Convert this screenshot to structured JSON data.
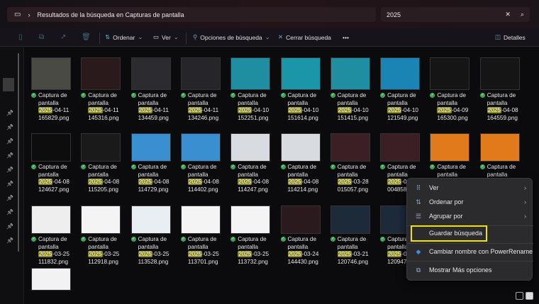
{
  "address": {
    "path": "Resultados de la búsqueda en Capturas de pantalla"
  },
  "search": {
    "value": "2025"
  },
  "toolbar": {
    "sort": "Ordenar",
    "view": "Ver",
    "search_options": "Opciones de búsqueda",
    "close_search": "Cerrar búsqueda",
    "more": "•••",
    "details": "Detalles"
  },
  "items": [
    {
      "l1": "Captura de",
      "l2": "pantalla",
      "hl": "2025",
      "date": "-04-11",
      "time": "165829.png",
      "thumb": "#4a4a44"
    },
    {
      "l1": "Captura de",
      "l2": "pantalla",
      "hl": "2025",
      "date": "-04-11",
      "time": "145316.png",
      "thumb": "#2a1a1c"
    },
    {
      "l1": "Captura de",
      "l2": "pantalla",
      "hl": "2025",
      "date": "-04-11",
      "time": "134459.png",
      "thumb": "#2c2c30"
    },
    {
      "l1": "Captura de",
      "l2": "pantalla",
      "hl": "2025",
      "date": "-04-11",
      "time": "134246.png",
      "thumb": "#26262a"
    },
    {
      "l1": "Captura de",
      "l2": "pantalla",
      "hl": "2025",
      "date": "-04-10",
      "time": "152251.png",
      "thumb": "#1e8ea0"
    },
    {
      "l1": "Captura de",
      "l2": "pantalla",
      "hl": "2025",
      "date": "-04-10",
      "time": "151614.png",
      "thumb": "#1b95a8"
    },
    {
      "l1": "Captura de",
      "l2": "pantalla",
      "hl": "2025",
      "date": "-04-10",
      "time": "151415.png",
      "thumb": "#1e8ea0"
    },
    {
      "l1": "Captura de",
      "l2": "pantalla",
      "hl": "2025",
      "date": "-04-10",
      "time": "121549.png",
      "thumb": "#1a84b5"
    },
    {
      "l1": "Captura de",
      "l2": "pantalla",
      "hl": "2025",
      "date": "-04-09",
      "time": "165300.png",
      "thumb": "#151515"
    },
    {
      "l1": "Captura de",
      "l2": "pantalla",
      "hl": "2025",
      "date": "-04-08",
      "time": "164559.png",
      "thumb": "#151515"
    },
    {
      "l1": "Captura de",
      "l2": "pantalla",
      "hl": "2025",
      "date": "-04-08",
      "time": "124627.png",
      "thumb": "#0d0d0d"
    },
    {
      "l1": "Captura de",
      "l2": "pantalla",
      "hl": "2025",
      "date": "-04-08",
      "time": "115205.png",
      "thumb": "#1a1a1a"
    },
    {
      "l1": "Captura de",
      "l2": "pantalla",
      "hl": "2025",
      "date": "-04-08",
      "time": "114729.png",
      "thumb": "#3a8fd0"
    },
    {
      "l1": "Captura de",
      "l2": "pantalla",
      "hl": "2025",
      "date": "-04-08",
      "time": "114402.png",
      "thumb": "#3a8fd0"
    },
    {
      "l1": "Captura de",
      "l2": "pantalla",
      "hl": "2025",
      "date": "-04-08",
      "time": "114247.png",
      "thumb": "#d8dce0"
    },
    {
      "l1": "Captura de",
      "l2": "pantalla",
      "hl": "2025",
      "date": "-04-08",
      "time": "114214.png",
      "thumb": "#d8dce0"
    },
    {
      "l1": "Captura de",
      "l2": "pantalla",
      "hl": "2025",
      "date": "-03-28",
      "time": "015057.png",
      "thumb": "#3a2024"
    },
    {
      "l1": "Captura de",
      "l2": "pantalla",
      "hl": "2025",
      "date": "-03-",
      "time": "004858.png",
      "thumb": "#3a2024"
    },
    {
      "l1": "Captura de",
      "l2": "pantalla",
      "hl": "",
      "date": "",
      "time": "",
      "thumb": "#e07a1a"
    },
    {
      "l1": "Captura de",
      "l2": "pantalla",
      "hl": "",
      "date": "",
      "time": "",
      "thumb": "#e07a1a"
    },
    {
      "l1": "Captura de",
      "l2": "pantalla",
      "hl": "2025",
      "date": "-03-25",
      "time": "111832.png",
      "thumb": "#eeeeee"
    },
    {
      "l1": "Captura de",
      "l2": "pantalla",
      "hl": "2025",
      "date": "-03-25",
      "time": "112918.png",
      "thumb": "#f4f4f4"
    },
    {
      "l1": "Captura de",
      "l2": "pantalla",
      "hl": "2025",
      "date": "-03-25",
      "time": "113528.png",
      "thumb": "#e8eef2"
    },
    {
      "l1": "Captura de",
      "l2": "pantalla",
      "hl": "2025",
      "date": "-03-25",
      "time": "113701.png",
      "thumb": "#f4f4f4"
    },
    {
      "l1": "Captura de",
      "l2": "pantalla",
      "hl": "2025",
      "date": "-03-25",
      "time": "113732.png",
      "thumb": "#f4f4f4"
    },
    {
      "l1": "Captura de",
      "l2": "pantalla",
      "hl": "2025",
      "date": "-03-24",
      "time": "144430.png",
      "thumb": "#2a1a1e"
    },
    {
      "l1": "Captura de",
      "l2": "pantalla",
      "hl": "2025",
      "date": "-03-21",
      "time": "120746.png",
      "thumb": "#1c2a3a"
    },
    {
      "l1": "Captura",
      "l2": "pantalla",
      "hl": "2025",
      "date": "-03-",
      "time": "120947.p",
      "thumb": "#1c2a3a"
    },
    {
      "l1": "",
      "l2": "",
      "hl": "",
      "date": "",
      "time": "",
      "thumb": "#1a2638"
    },
    {
      "l1": "",
      "l2": "",
      "hl": "",
      "date": "",
      "time": "",
      "thumb": "#1c1c1c"
    },
    {
      "l1": "",
      "l2": "",
      "hl": "",
      "date": "",
      "time": "",
      "thumb": "#f2f2f2"
    }
  ],
  "menu": {
    "view": "Ver",
    "sort_by": "Ordenar por",
    "group_by": "Agrupar por",
    "save_search": "Guardar búsqueda",
    "powerrename": "Cambiar nombre con PowerRename",
    "more_options": "Mostrar Más opciones"
  },
  "colors": {
    "highlight": "#f2e400",
    "check": "#3aa655"
  }
}
